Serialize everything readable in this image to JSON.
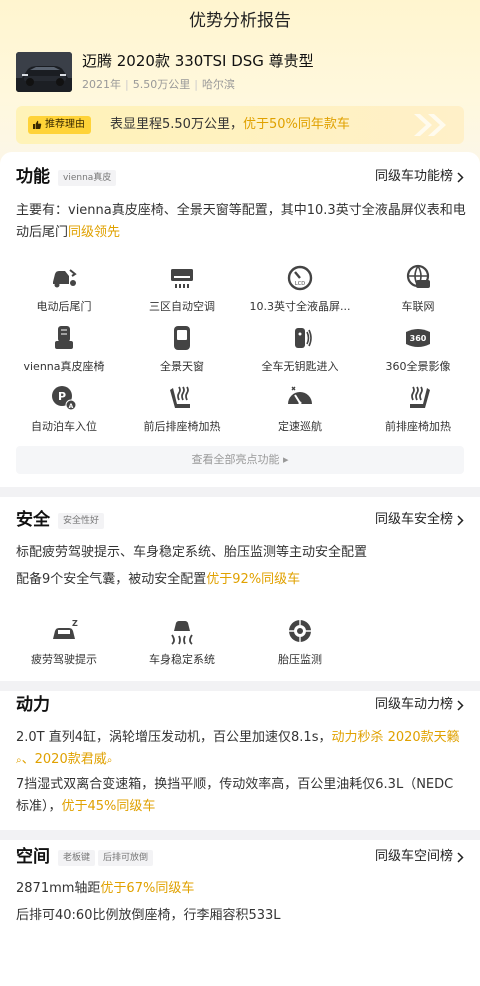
{
  "header": {
    "title": "优势分析报告",
    "car_name": "迈腾 2020款 330TSI DSG 尊贵型",
    "meta": [
      "2021年",
      "5.50万公里",
      "哈尔滨"
    ]
  },
  "reason": {
    "tag": "推荐理由",
    "text_plain": "表显里程5.50万公里，",
    "text_highlight": "优于50%同年款车"
  },
  "features": {
    "title": "功能",
    "badge": "vienna真皮",
    "link": "同级车功能榜",
    "desc_plain": "主要有：vienna真皮座椅、全景天窗等配置，其中10.3英寸全液晶屏仪表和电动后尾门",
    "desc_highlight": "同级领先",
    "items": [
      {
        "label": "电动后尾门",
        "icon": "trunk-icon"
      },
      {
        "label": "三区自动空调",
        "icon": "climate-icon"
      },
      {
        "label": "10.3英寸全液晶屏...",
        "icon": "lcd-gauge-icon"
      },
      {
        "label": "车联网",
        "icon": "connected-car-icon"
      },
      {
        "label": "vienna真皮座椅",
        "icon": "leather-seat-icon"
      },
      {
        "label": "全景天窗",
        "icon": "sunroof-icon"
      },
      {
        "label": "全车无钥匙进入",
        "icon": "keyless-entry-icon"
      },
      {
        "label": "360全景影像",
        "icon": "camera-360-icon"
      },
      {
        "label": "自动泊车入位",
        "icon": "auto-parking-icon"
      },
      {
        "label": "前后排座椅加热",
        "icon": "seat-heat-icon"
      },
      {
        "label": "定速巡航",
        "icon": "cruise-icon"
      },
      {
        "label": "前排座椅加热",
        "icon": "seat-heat-front-icon"
      }
    ],
    "view_all": "查看全部亮点功能"
  },
  "safety": {
    "title": "安全",
    "badge": "安全性好",
    "link": "同级车安全榜",
    "line1": "标配疲劳驾驶提示、车身稳定系统、胎压监测等主动安全配置",
    "line2_plain": "配备9个安全气囊，被动安全配置",
    "line2_highlight": "优于92%同级车",
    "items": [
      {
        "label": "疲劳驾驶提示",
        "icon": "fatigue-icon"
      },
      {
        "label": "车身稳定系统",
        "icon": "stability-icon"
      },
      {
        "label": "胎压监测",
        "icon": "tire-pressure-icon"
      }
    ]
  },
  "power": {
    "title": "动力",
    "link": "同级车动力榜",
    "line1_plain": "2.0T 直列4缸，涡轮增压发动机，百公里加速仅8.1s，",
    "line1_highlight": "动力秒杀 2020款天籁",
    "line1_sep": "、",
    "line1_highlight2": "2020款君威",
    "line2_plain": "7挡湿式双离合变速箱，换挡平顺，传动效率高，百公里油耗仅6.3L（NEDC标准），",
    "line2_highlight": "优于45%同级车"
  },
  "space": {
    "title": "空间",
    "badges": [
      "老板键",
      "后排可放倒"
    ],
    "link": "同级车空间榜",
    "line1_plain": "2871mm轴距",
    "line1_highlight": "优于67%同级车",
    "line2": "后排可40:60比例放倒座椅，行李厢容积533L"
  },
  "colors": {
    "accent": "#e0a100",
    "tag_bg": "#ffd338"
  }
}
